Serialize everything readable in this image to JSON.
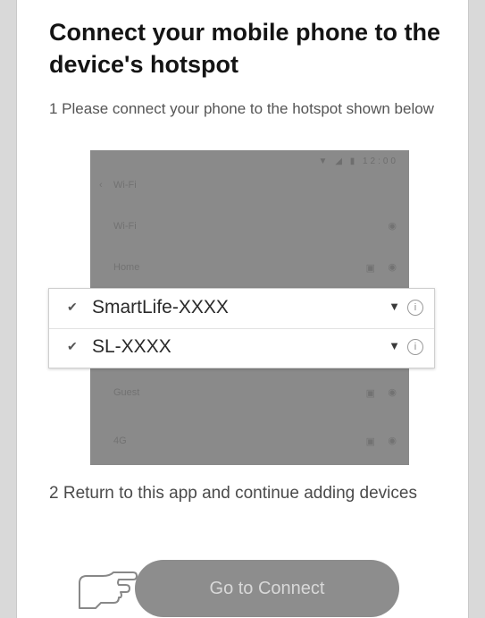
{
  "title": "Connect your mobile phone to the device's hotspot",
  "step1": "1  Please connect your phone to the hotspot shown below",
  "phone_list": {
    "status": "▼ ◢ ▮ 12:00",
    "rows": [
      {
        "label": "Wi-Fi",
        "lock": "",
        "wifi": ""
      },
      {
        "label": "Wi-Fi",
        "lock": "",
        "wifi": "◉"
      },
      {
        "label": "Home",
        "lock": "▣",
        "wifi": "◉"
      },
      {
        "label": "Guest",
        "lock": "▣",
        "wifi": "◉"
      },
      {
        "label": "4G",
        "lock": "▣",
        "wifi": "◉"
      }
    ]
  },
  "networks": [
    {
      "check": "✔",
      "name": "SmartLife-XXXX",
      "signal_icon": "wifi-icon",
      "info_icon": "info-icon"
    },
    {
      "check": "✔",
      "name": "SL-XXXX",
      "signal_icon": "wifi-icon",
      "info_icon": "info-icon"
    }
  ],
  "step2": "2  Return to this app and continue adding devices",
  "connect_button": "Go to Connect",
  "colors": {
    "button": "#8d8d8d",
    "button_text": "#d8d8d8",
    "phone_bg": "#8a8a8a",
    "title": "#141414"
  }
}
